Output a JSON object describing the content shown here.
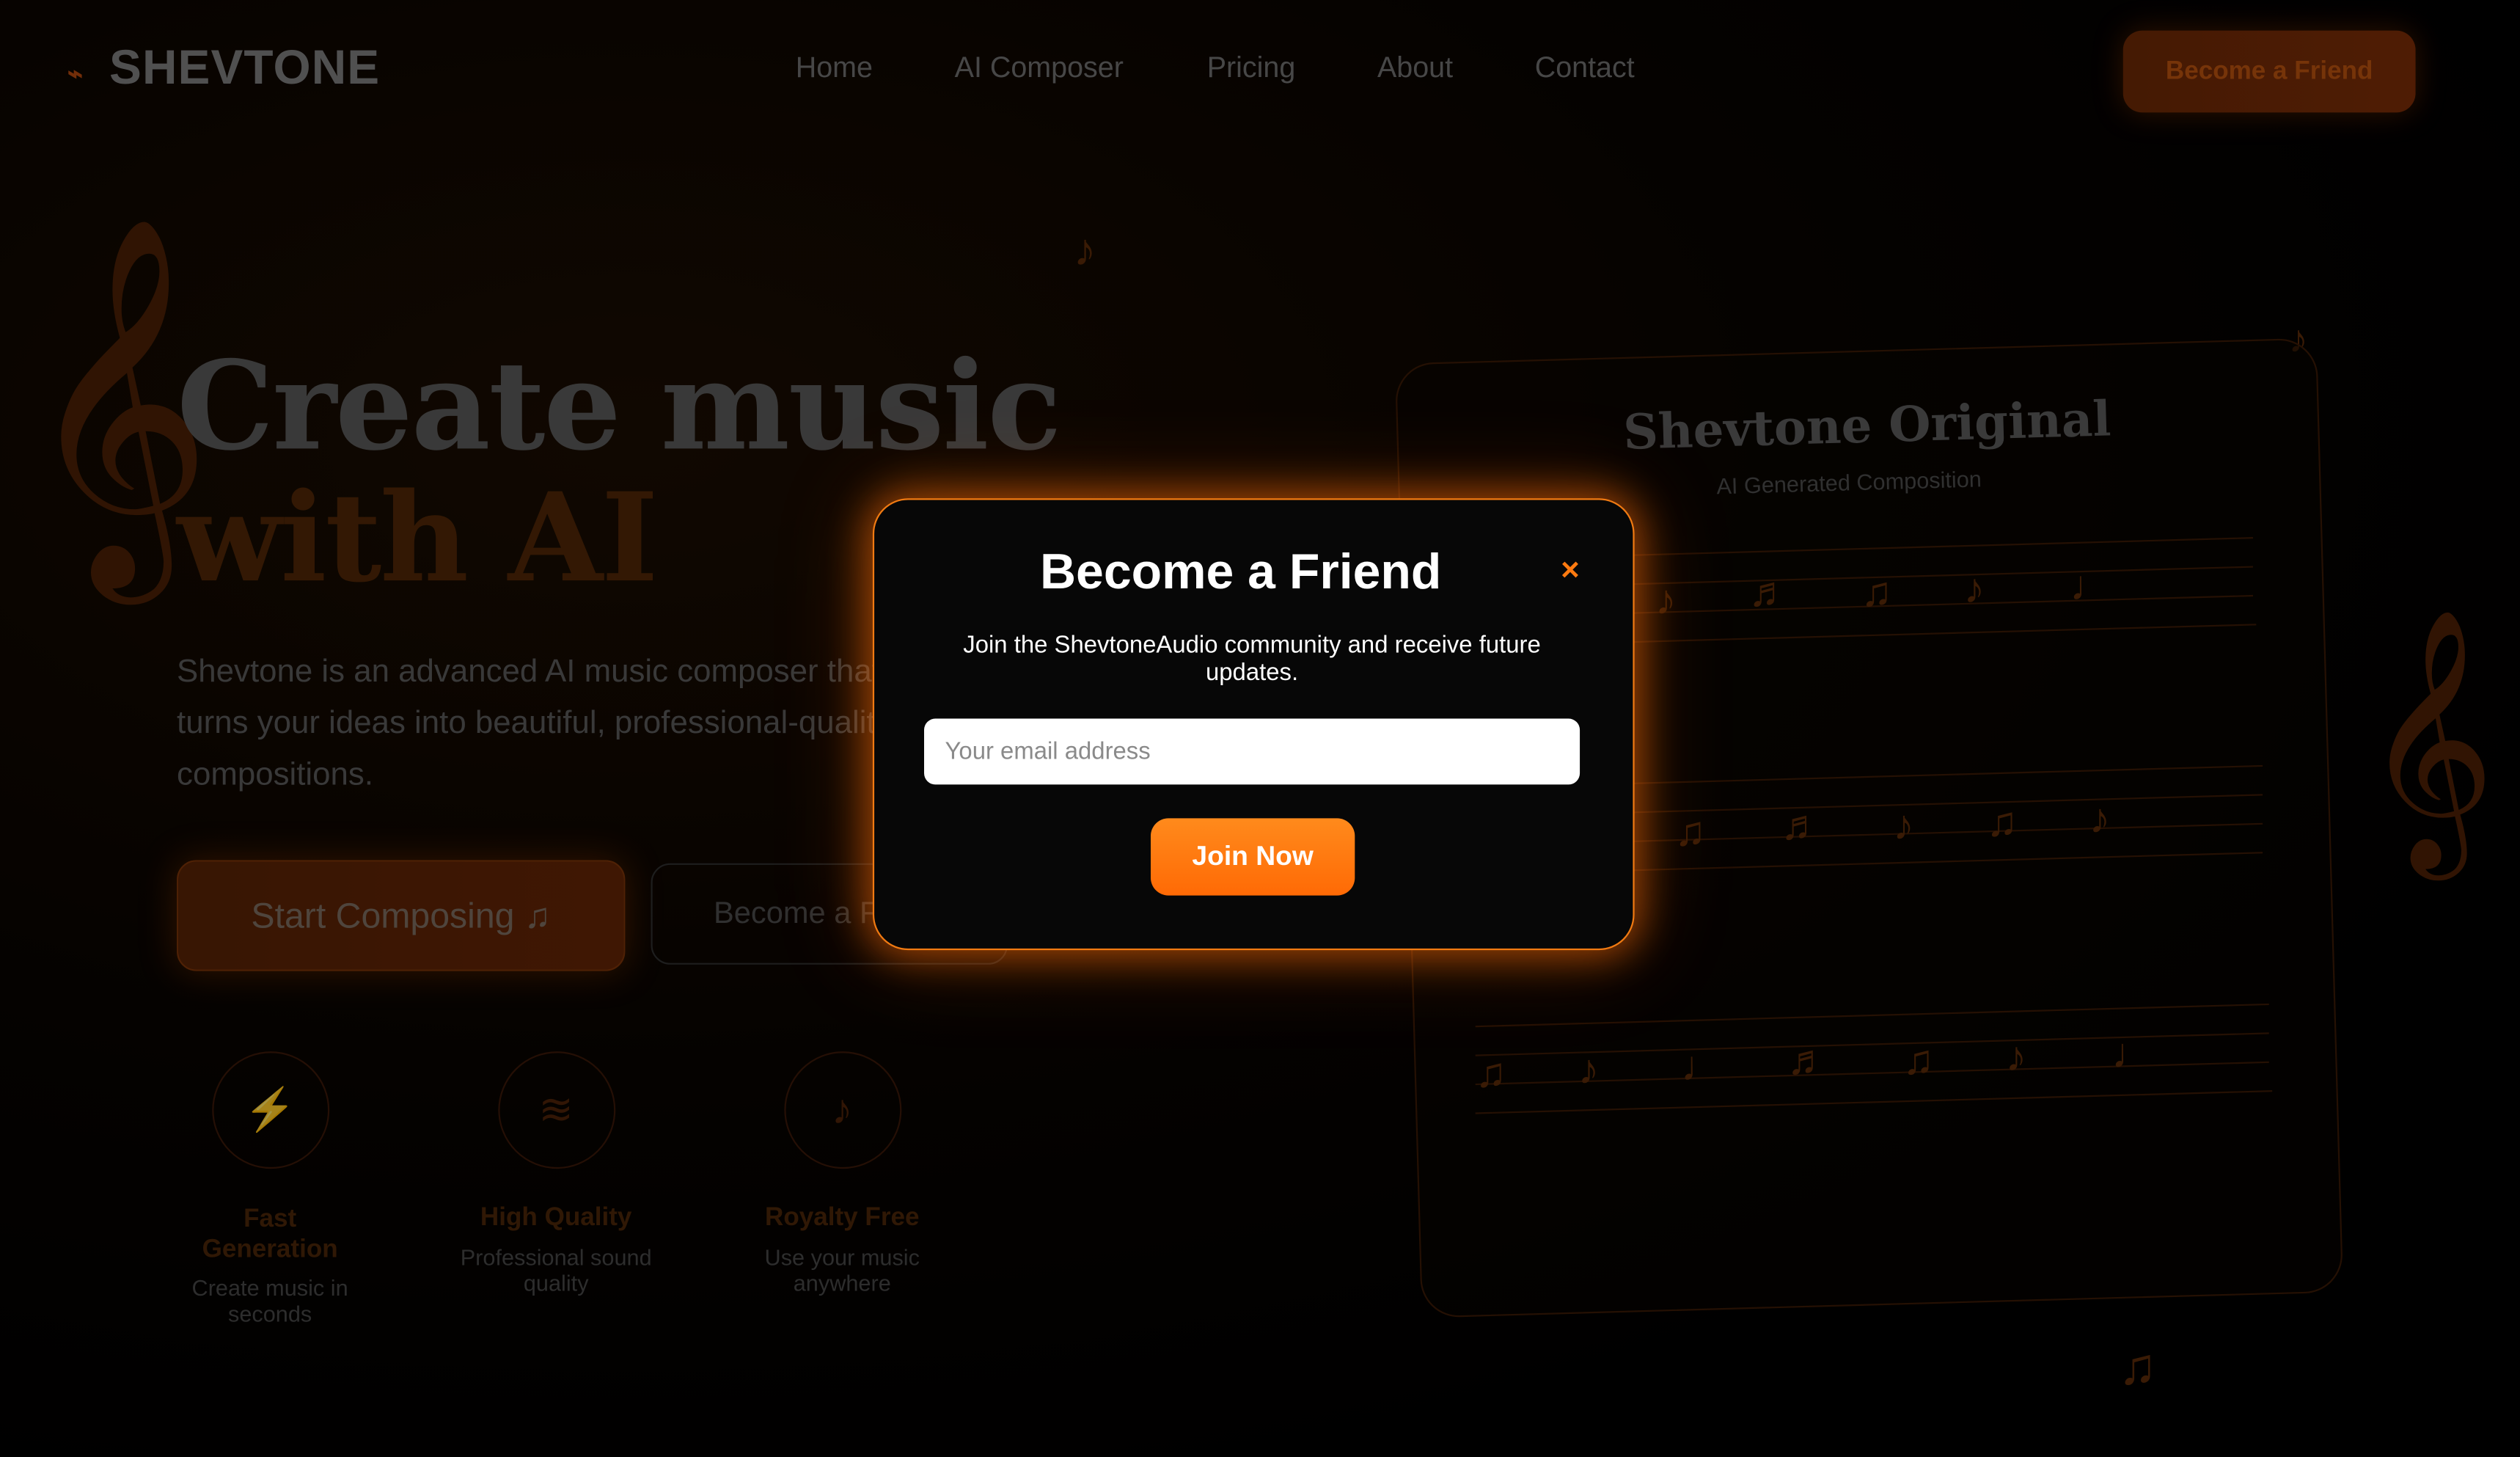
{
  "nav": {
    "logo_mark": "⌁",
    "logo": "SHEVTONE",
    "links": [
      "Home",
      "AI Composer",
      "Pricing",
      "About",
      "Contact"
    ],
    "cta": "Become a Friend"
  },
  "hero": {
    "title_line1": "Create music",
    "title_line2": "with AI",
    "description": "Shevtone is an advanced AI music composer that turns your ideas into beautiful, professional-quality compositions.",
    "start_button": "Start Composing ♫",
    "friend_button": "Become a Friend"
  },
  "features": [
    {
      "icon": "lightning-icon",
      "glyph": "⚡",
      "title": "Fast Generation",
      "desc": "Create music in seconds"
    },
    {
      "icon": "waves-icon",
      "glyph": "≋",
      "title": "High Quality",
      "desc": "Professional sound quality"
    },
    {
      "icon": "music-note-icon",
      "glyph": "♪",
      "title": "Royalty Free",
      "desc": "Use your music anywhere"
    }
  ],
  "sheet": {
    "title": "Shevtone Original",
    "subtitle": "AI Generated Composition"
  },
  "modal": {
    "title": "Become a Friend",
    "close": "×",
    "description": "Join the ShevtoneAudio community and receive future updates.",
    "email_placeholder": "Your email address",
    "email_value": "",
    "submit": "Join Now"
  },
  "colors": {
    "accent": "#ff7a10",
    "background": "#000000"
  }
}
